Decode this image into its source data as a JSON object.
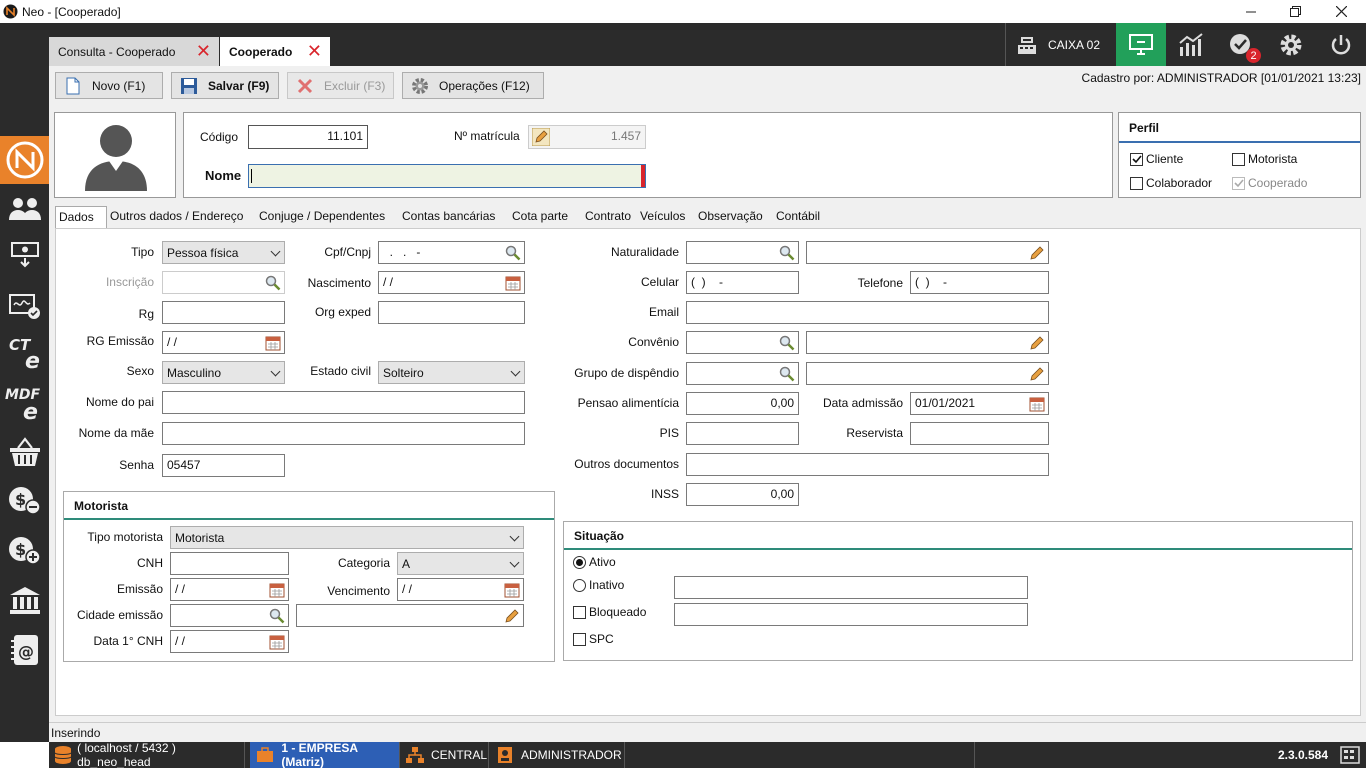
{
  "window": {
    "title": "Neo - [Cooperado]"
  },
  "tabs": [
    {
      "label": "Consulta - Cooperado"
    },
    {
      "label": "Cooperado"
    }
  ],
  "topbar": {
    "caixa_label": "CAIXA 02",
    "notification_count": "2"
  },
  "toolbar": {
    "novo": "Novo (F1)",
    "salvar": "Salvar (F9)",
    "excluir": "Excluir (F3)",
    "operacoes": "Operações (F12)",
    "cadastro_por": "Cadastro por: ADMINISTRADOR [01/01/2021 13:23]"
  },
  "header": {
    "codigo_label": "Código",
    "codigo_value": "11.101",
    "matricula_label": "Nº matrícula",
    "matricula_value": "1.457",
    "nome_label": "Nome",
    "nome_value": ""
  },
  "perfil": {
    "title": "Perfil",
    "cliente": "Cliente",
    "motorista": "Motorista",
    "colaborador": "Colaborador",
    "cooperado": "Cooperado"
  },
  "data_tabs": [
    "Dados",
    "Outros dados / Endereço",
    "Conjuge / Dependentes",
    "Contas bancárias",
    "Cota parte",
    "Contrato",
    "Veículos",
    "Observação",
    "Contábil"
  ],
  "dados": {
    "tipo_label": "Tipo",
    "tipo_value": "Pessoa física",
    "inscricao_label": "Inscrição",
    "rg_label": "Rg",
    "rg_emissao_label": "RG Emissão",
    "rg_emissao_value": " / /",
    "sexo_label": "Sexo",
    "sexo_value": "Masculino",
    "nome_pai_label": "Nome do pai",
    "nome_mae_label": "Nome da mãe",
    "senha_label": "Senha",
    "senha_value": "05457",
    "cpf_label": "Cpf/Cnpj",
    "cpf_value": "  .   .   -",
    "nascimento_label": "Nascimento",
    "nascimento_value": " / /",
    "org_exped_label": "Org exped",
    "estado_civil_label": "Estado civil",
    "estado_civil_value": "Solteiro",
    "naturalidade_label": "Naturalidade",
    "celular_label": "Celular",
    "celular_value": "(  )    -",
    "telefone_label": "Telefone",
    "telefone_value": "(  )    -",
    "email_label": "Email",
    "convenio_label": "Convênio",
    "grupo_label": "Grupo de dispêndio",
    "pensao_label": "Pensao alimentícia",
    "pensao_value": "0,00",
    "data_admissao_label": "Data admissão",
    "data_admissao_value": "01/01/2021",
    "pis_label": "PIS",
    "reservista_label": "Reservista",
    "outros_docs_label": "Outros documentos",
    "inss_label": "INSS",
    "inss_value": "0,00"
  },
  "motorista": {
    "title": "Motorista",
    "tipo_label": "Tipo motorista",
    "tipo_value": "Motorista",
    "cnh_label": "CNH",
    "categoria_label": "Categoria",
    "categoria_value": "A",
    "emissao_label": "Emissão",
    "emissao_value": " / /",
    "vencimento_label": "Vencimento",
    "vencimento_value": " / /",
    "cidade_label": "Cidade emissão",
    "data_cnh_label": "Data 1° CNH",
    "data_cnh_value": " / /"
  },
  "situacao": {
    "title": "Situação",
    "ativo": "Ativo",
    "inativo": "Inativo",
    "bloqueado": "Bloqueado",
    "spc": "SPC"
  },
  "status": {
    "text": "Inserindo"
  },
  "bottombar": {
    "db": "( localhost / 5432 ) db_neo_head",
    "empresa": "1 - EMPRESA (Matriz)",
    "central": "CENTRAL",
    "user": "ADMINISTRADOR",
    "version": "2.3.0.584"
  },
  "colors": {
    "accent": "#2e8b7a",
    "dark": "#2b2b2b",
    "green": "#22a05a",
    "brand_orange": "#e9822a",
    "close_red": "#d9252c"
  }
}
